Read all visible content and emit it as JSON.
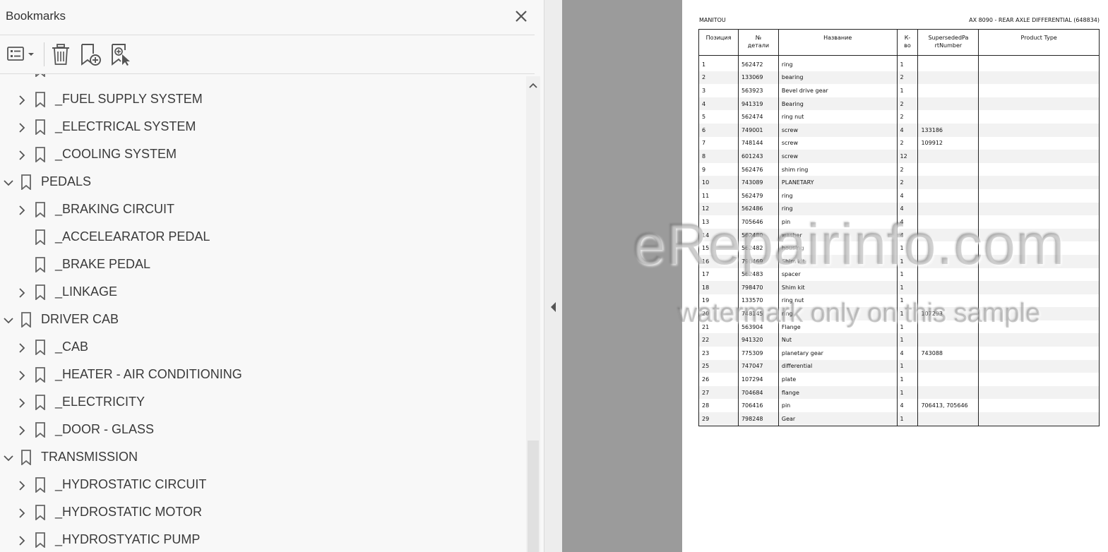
{
  "panel": {
    "title": "Bookmarks"
  },
  "tree": [
    {
      "label": "_FUEL SUPPLY SYSTEM",
      "level": 1,
      "chevron": "right"
    },
    {
      "label": "_ELECTRICAL SYSTEM",
      "level": 1,
      "chevron": "right"
    },
    {
      "label": "_COOLING SYSTEM",
      "level": 1,
      "chevron": "right"
    },
    {
      "label": "PEDALS",
      "level": 0,
      "chevron": "down"
    },
    {
      "label": "_BRAKING CIRCUIT",
      "level": 1,
      "chevron": "right"
    },
    {
      "label": "_ACCELEARATOR PEDAL",
      "level": 1,
      "chevron": "none"
    },
    {
      "label": "_BRAKE PEDAL",
      "level": 1,
      "chevron": "none"
    },
    {
      "label": "_LINKAGE",
      "level": 1,
      "chevron": "right"
    },
    {
      "label": "DRIVER CAB",
      "level": 0,
      "chevron": "down"
    },
    {
      "label": "_CAB",
      "level": 1,
      "chevron": "right"
    },
    {
      "label": "_HEATER - AIR CONDITIONING",
      "level": 1,
      "chevron": "right"
    },
    {
      "label": "_ELECTRICITY",
      "level": 1,
      "chevron": "right"
    },
    {
      "label": "_DOOR - GLASS",
      "level": 1,
      "chevron": "right"
    },
    {
      "label": "TRANSMISSION",
      "level": 0,
      "chevron": "down"
    },
    {
      "label": "_HYDROSTATIC CIRCUIT",
      "level": 1,
      "chevron": "right"
    },
    {
      "label": "_HYDROSTATIC MOTOR",
      "level": 1,
      "chevron": "right"
    },
    {
      "label": "_HYDROSTYATIC PUMP",
      "level": 1,
      "chevron": "right"
    }
  ],
  "document": {
    "header_left": "MANITOU",
    "header_right": "AX 8090 - REAR AXLE DIFFERENTIAL (648834)",
    "columns": [
      "Позиция",
      "№ детали",
      "Название",
      "К-во",
      "SupersededPartNumber",
      "Product Type"
    ],
    "column_lines": [
      [
        "Позиция"
      ],
      [
        "№",
        "детали"
      ],
      [
        "Название"
      ],
      [
        "К-",
        "во"
      ],
      [
        "SupersededPa",
        "rtNumber"
      ],
      [
        "Product Type"
      ]
    ],
    "rows": [
      [
        "1",
        "562472",
        "ring",
        "1",
        "",
        ""
      ],
      [
        "2",
        "133069",
        "bearing",
        "2",
        "",
        ""
      ],
      [
        "3",
        "563923",
        "Bevel drive gear",
        "1",
        "",
        ""
      ],
      [
        "4",
        "941319",
        "Bearing",
        "2",
        "",
        ""
      ],
      [
        "5",
        "562474",
        "ring nut",
        "2",
        "",
        ""
      ],
      [
        "6",
        "749001",
        "screw",
        "4",
        "133186",
        ""
      ],
      [
        "7",
        "748144",
        "screw",
        "2",
        "109912",
        ""
      ],
      [
        "8",
        "601243",
        "screw",
        "12",
        "",
        ""
      ],
      [
        "9",
        "562476",
        "shim ring",
        "2",
        "",
        ""
      ],
      [
        "10",
        "743089",
        "PLANETARY",
        "2",
        "",
        ""
      ],
      [
        "11",
        "562479",
        "ring",
        "4",
        "",
        ""
      ],
      [
        "12",
        "562486",
        "ring",
        "4",
        "",
        ""
      ],
      [
        "13",
        "705646",
        "pin",
        "4",
        "",
        ""
      ],
      [
        "14",
        "562480",
        "washer",
        "4",
        "",
        ""
      ],
      [
        "15",
        "562482",
        "housing",
        "1",
        "",
        ""
      ],
      [
        "16",
        "798469",
        "Shim kit",
        "1",
        "",
        ""
      ],
      [
        "17",
        "562483",
        "spacer",
        "1",
        "",
        ""
      ],
      [
        "18",
        "798470",
        "Shim kit",
        "1",
        "",
        ""
      ],
      [
        "19",
        "133570",
        "ring nut",
        "1",
        "",
        ""
      ],
      [
        "20",
        "748145",
        "ring",
        "1",
        "107293",
        ""
      ],
      [
        "21",
        "563904",
        "Flange",
        "1",
        "",
        ""
      ],
      [
        "22",
        "941320",
        "Nut",
        "1",
        "",
        ""
      ],
      [
        "23",
        "775309",
        "planetary gear",
        "4",
        "743088",
        ""
      ],
      [
        "25",
        "747047",
        "differential",
        "1",
        "",
        ""
      ],
      [
        "26",
        "107294",
        "plate",
        "1",
        "",
        ""
      ],
      [
        "27",
        "704684",
        "flange",
        "1",
        "",
        ""
      ],
      [
        "28",
        "706416",
        "pin",
        "4",
        "706413, 705646",
        ""
      ],
      [
        "29",
        "798248",
        "Gear",
        "1",
        "",
        ""
      ]
    ]
  },
  "watermark": {
    "line1": "eRepairinfo.com",
    "line2": "watermark only on this sample"
  },
  "icons": {
    "close": "close-icon",
    "options": "options-menu-icon",
    "delete": "trash-icon",
    "new_bookmark": "new-bookmark-icon",
    "find_bookmark": "find-current-bookmark-icon",
    "bookmark": "bookmark-icon"
  }
}
